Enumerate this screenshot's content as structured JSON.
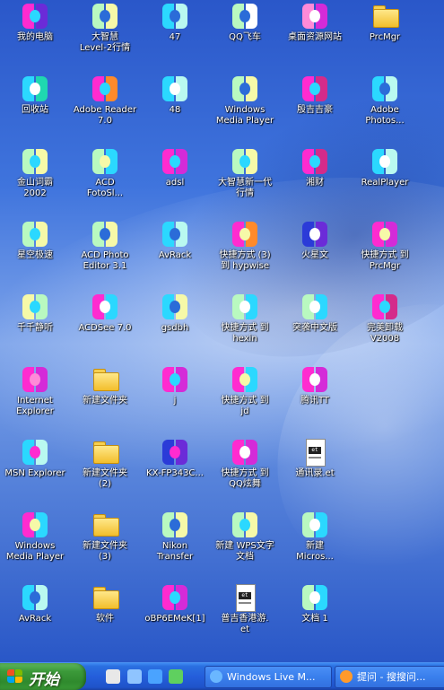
{
  "desktop": {
    "icons": [
      {
        "label": "我的电脑",
        "kind": "app",
        "c1": "#ff2bd0",
        "c2": "#6b2bd8",
        "c3": "#2bd8ff"
      },
      {
        "label": "大智慧\nLevel-2行情",
        "kind": "app",
        "c1": "#b9f9c0",
        "c2": "#f6f9a8",
        "c3": "#2b6cd8"
      },
      {
        "label": "47",
        "kind": "app",
        "c1": "#2bd8ff",
        "c2": "#b9f9f0",
        "c3": "#2b6cd8"
      },
      {
        "label": "QQ飞车",
        "kind": "app",
        "c1": "#b9f9c0",
        "c2": "#ffffff",
        "c3": "#2b6cd8"
      },
      {
        "label": "桌面资源网站",
        "kind": "app",
        "c1": "#ff8ad8",
        "c2": "#d42bd8",
        "c3": "#ffffff"
      },
      {
        "label": "PrcMgr",
        "kind": "folder"
      },
      {
        "label": "回收站",
        "kind": "app",
        "c1": "#2bd8ff",
        "c2": "#1fd7b0",
        "c3": "#ffffff"
      },
      {
        "label": "Adobe Reader\n7.0",
        "kind": "app",
        "c1": "#ff2bd0",
        "c2": "#ff8a2b",
        "c3": "#2bd8ff"
      },
      {
        "label": "48",
        "kind": "app",
        "c1": "#2bd8ff",
        "c2": "#b9f9f0",
        "c3": "#ffffff"
      },
      {
        "label": "Windows\nMedia Player",
        "kind": "app",
        "c1": "#b9f9c0",
        "c2": "#f6f9a8",
        "c3": "#2b6cd8"
      },
      {
        "label": "殷吉吉豪",
        "kind": "app",
        "c1": "#ff2bd0",
        "c2": "#d42b8a",
        "c3": "#2bd8ff"
      },
      {
        "label": "Adobe\nPhotos...",
        "kind": "app",
        "c1": "#2bd8ff",
        "c2": "#b9f9f0",
        "c3": "#2b6cd8"
      },
      {
        "label": "金山词霸\n2002",
        "kind": "app",
        "c1": "#b9f9c0",
        "c2": "#f6f9a8",
        "c3": "#2bd8ff"
      },
      {
        "label": "ACD\nFotoSl...",
        "kind": "app",
        "c1": "#b9f9c0",
        "c2": "#2bd8ff",
        "c3": "#f6f9a8"
      },
      {
        "label": "adsl",
        "kind": "app",
        "c1": "#ff2bd0",
        "c2": "#d42bd8",
        "c3": "#2bd8ff"
      },
      {
        "label": "大智慧新一代\n行情",
        "kind": "app",
        "c1": "#b9f9c0",
        "c2": "#f6f9a8",
        "c3": "#2bd8ff"
      },
      {
        "label": "湘财",
        "kind": "app",
        "c1": "#ff2bd0",
        "c2": "#d42b8a",
        "c3": "#2bd8ff"
      },
      {
        "label": "RealPlayer",
        "kind": "app",
        "c1": "#2bd8ff",
        "c2": "#b9f9f0",
        "c3": "#ffffff"
      },
      {
        "label": "星空极速",
        "kind": "app",
        "c1": "#b9f9c0",
        "c2": "#f6f9a8",
        "c3": "#2bd8ff"
      },
      {
        "label": "ACD Photo\nEditor 3.1",
        "kind": "app",
        "c1": "#b9f9c0",
        "c2": "#f6f9a8",
        "c3": "#2b6cd8"
      },
      {
        "label": "AvRack",
        "kind": "app",
        "c1": "#2bd8ff",
        "c2": "#b9f9f0",
        "c3": "#2b6cd8"
      },
      {
        "label": "快捷方式 (3)\n到 hypwise",
        "kind": "app",
        "c1": "#ff2bd0",
        "c2": "#ff8a2b",
        "c3": "#f6f9a8"
      },
      {
        "label": "火星文",
        "kind": "app",
        "c1": "#2b3bd8",
        "c2": "#6b2bd8",
        "c3": "#ffffff"
      },
      {
        "label": "快捷方式 到\nPrcMgr",
        "kind": "app",
        "c1": "#ff2bd0",
        "c2": "#d42bd8",
        "c3": "#f6f9a8"
      },
      {
        "label": "千千静听",
        "kind": "app",
        "c1": "#f6f9a8",
        "c2": "#b9f9c0",
        "c3": "#2bd8ff"
      },
      {
        "label": "ACDSee 7.0",
        "kind": "app",
        "c1": "#ff2bd0",
        "c2": "#2bd8ff",
        "c3": "#ffffff"
      },
      {
        "label": "gsdbh",
        "kind": "app",
        "c1": "#2bd8ff",
        "c2": "#f6f9a8",
        "c3": "#2b6cd8"
      },
      {
        "label": "快捷方式 到\nhexin",
        "kind": "app",
        "c1": "#b9f9c0",
        "c2": "#2bd8ff",
        "c3": "#ffffff"
      },
      {
        "label": "突袭中文版",
        "kind": "app",
        "c1": "#b9f9c0",
        "c2": "#2bd8ff",
        "c3": "#ffffff"
      },
      {
        "label": "完美卸载\nV2008",
        "kind": "app",
        "c1": "#ff2bd0",
        "c2": "#d42b8a",
        "c3": "#2bd8ff"
      },
      {
        "label": "Internet\nExplorer",
        "kind": "app",
        "c1": "#ff2bd0",
        "c2": "#d42bd8",
        "c3": "#ff8ad8"
      },
      {
        "label": "新建文件夹",
        "kind": "folder"
      },
      {
        "label": "j",
        "kind": "app",
        "c1": "#ff2bd0",
        "c2": "#d42bd8",
        "c3": "#2bd8ff"
      },
      {
        "label": "快捷方式 到\njd",
        "kind": "app",
        "c1": "#ff2bd0",
        "c2": "#2bd8ff",
        "c3": "#f6f9a8"
      },
      {
        "label": "腾讯TT",
        "kind": "app",
        "c1": "#ff2bd0",
        "c2": "#d42bd8",
        "c3": "#ffffff"
      },
      {
        "label": "",
        "kind": "none"
      },
      {
        "label": "MSN Explorer",
        "kind": "app",
        "c1": "#2bd8ff",
        "c2": "#b9f9f0",
        "c3": "#ff2bd0"
      },
      {
        "label": "新建文件夹\n(2)",
        "kind": "folder"
      },
      {
        "label": "KX-FP343C...",
        "kind": "app",
        "c1": "#2b3bd8",
        "c2": "#6b2bd8",
        "c3": "#ff2bd0"
      },
      {
        "label": "快捷方式 到\nQQ炫舞",
        "kind": "app",
        "c1": "#ff2bd0",
        "c2": "#d42bd8",
        "c3": "#ffffff"
      },
      {
        "label": "通讯录.et",
        "kind": "doc"
      },
      {
        "label": "",
        "kind": "none"
      },
      {
        "label": "Windows\nMedia Player",
        "kind": "app",
        "c1": "#ff2bd0",
        "c2": "#2bd8ff",
        "c3": "#f6f9a8"
      },
      {
        "label": "新建文件夹\n(3)",
        "kind": "folder"
      },
      {
        "label": "Nikon\nTransfer",
        "kind": "app",
        "c1": "#b9f9c0",
        "c2": "#f6f9a8",
        "c3": "#2b6cd8"
      },
      {
        "label": "新建 WPS文字\n文档",
        "kind": "app",
        "c1": "#b9f9c0",
        "c2": "#f6f9a8",
        "c3": "#2bd8ff"
      },
      {
        "label": "新建\nMicros...",
        "kind": "app",
        "c1": "#b9f9c0",
        "c2": "#2bd8ff",
        "c3": "#ffffff"
      },
      {
        "label": "",
        "kind": "none"
      },
      {
        "label": "AvRack",
        "kind": "app",
        "c1": "#2bd8ff",
        "c2": "#b9f9f0",
        "c3": "#2b6cd8"
      },
      {
        "label": "软件",
        "kind": "folder"
      },
      {
        "label": "oBP6EMeK[1]",
        "kind": "app",
        "c1": "#ff2bd0",
        "c2": "#d42bd8",
        "c3": "#2bd8ff"
      },
      {
        "label": "普吉香港游.\net",
        "kind": "doc"
      },
      {
        "label": "文档 1",
        "kind": "app",
        "c1": "#b9f9c0",
        "c2": "#2bd8ff",
        "c3": "#ffffff"
      },
      {
        "label": "",
        "kind": "none"
      }
    ]
  },
  "taskbar": {
    "start_label": "开始",
    "quick_launch": [
      {
        "name": "windows-media-icon",
        "color": "#e8e8e8"
      },
      {
        "name": "show-desktop-icon",
        "color": "#8fc4ff"
      },
      {
        "name": "internet-explorer-icon",
        "color": "#4aa3ff"
      },
      {
        "name": "msn-icon",
        "color": "#5fd05f"
      }
    ],
    "tasks": [
      {
        "label": "Windows Live M...",
        "icon_color": "#6ab7ff"
      },
      {
        "label": "提问 - 搜搜问...",
        "icon_color": "#ff9a2b"
      }
    ]
  },
  "colors": {
    "desktop_top": "#2a57c9",
    "desktop_mid": "#7ea4ea",
    "taskbar": "#245edb",
    "start": "#3c9a3a"
  }
}
